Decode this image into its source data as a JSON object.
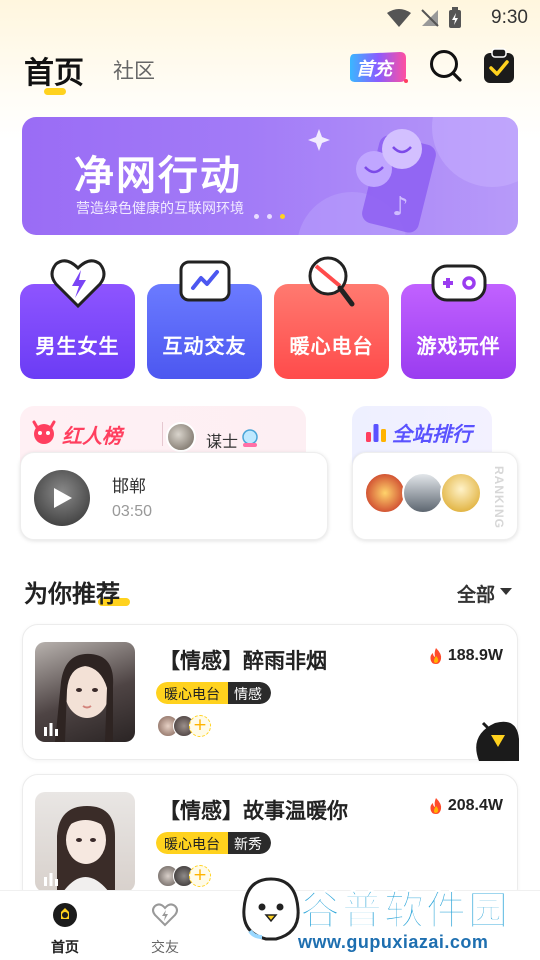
{
  "status_bar": {
    "time": "9:30"
  },
  "header": {
    "tabs": [
      {
        "label": "首页"
      },
      {
        "label": "社区"
      }
    ],
    "recharge_badge": "首充"
  },
  "banner": {
    "title": "净网行动",
    "subtitle": "营造绿色健康的互联网环境",
    "dot_count": 3,
    "active_dot": 3
  },
  "categories": [
    {
      "label": "男生女生",
      "color_from": "#8e55ff",
      "color_to": "#6b3cf5"
    },
    {
      "label": "互动交友",
      "color_from": "#6b7bff",
      "color_to": "#4c57f0"
    },
    {
      "label": "暖心电台",
      "color_from": "#ff7a70",
      "color_to": "#ff4b4b"
    },
    {
      "label": "游戏玩伴",
      "color_from": "#c162ff",
      "color_to": "#9a3cf0"
    }
  ],
  "hot_rank": {
    "title": "红人榜",
    "user": "谋士",
    "song": "邯郸",
    "duration": "03:50"
  },
  "site_rank": {
    "title": "全站排行",
    "vertical_label": "RANKING"
  },
  "recommend": {
    "title": "为你推荐",
    "filter_label": "全部",
    "rooms": [
      {
        "name": "【情感】醉雨非烟",
        "heat": "188.9W",
        "tag_primary": "暖心电台",
        "tag_secondary": "情感"
      },
      {
        "name": "【情感】故事温暖你",
        "heat": "208.4W",
        "tag_primary": "暖心电台",
        "tag_secondary": "新秀"
      }
    ]
  },
  "bottom_nav": [
    {
      "label": "首页"
    },
    {
      "label": "交友"
    }
  ],
  "watermark": {
    "line1": "谷普软件园",
    "line2": "www.gupuxiazai.com"
  },
  "colors": {
    "accent_yellow": "#ffd21e",
    "banner_purple": "#9a6cf5",
    "hot_red": "#ff3f5f",
    "site_blue": "#5a52ff"
  }
}
